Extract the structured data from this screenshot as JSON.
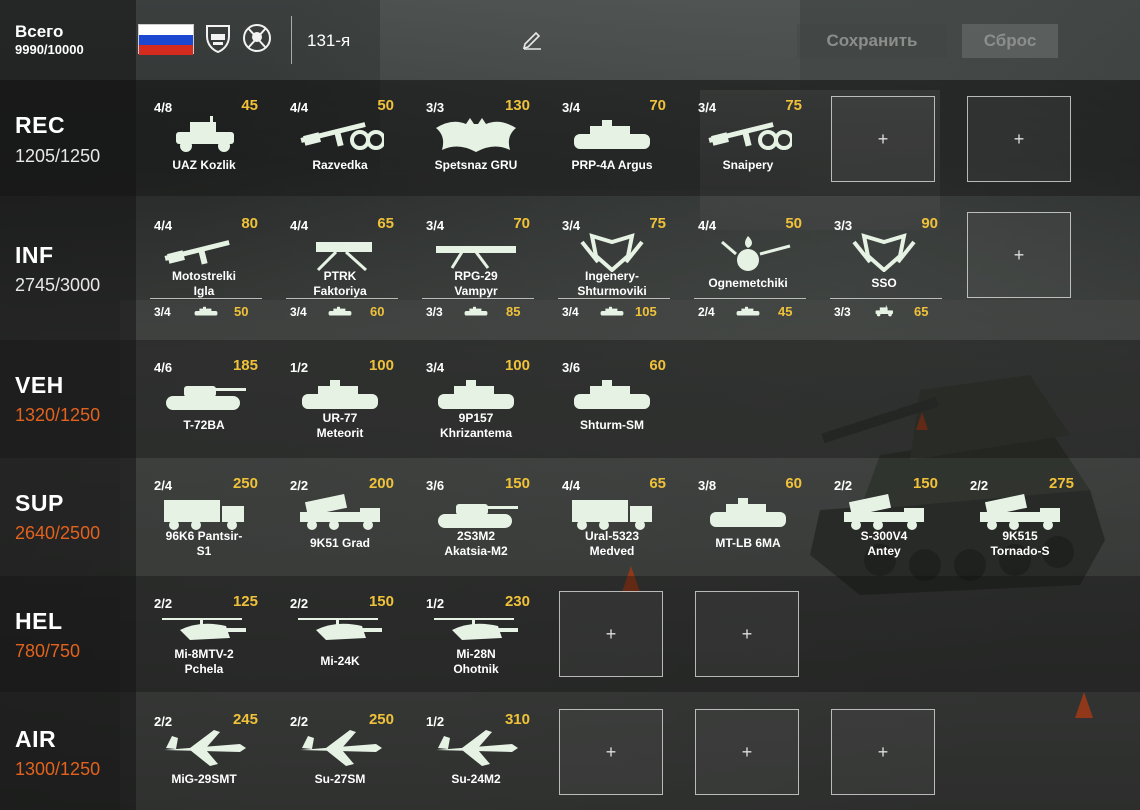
{
  "header": {
    "total_label": "Всего",
    "total_value": "9990/10000",
    "deck_name": "131-я",
    "save_label": "Сохранить",
    "reset_label": "Сброс",
    "flag_colors": [
      "#ffffff",
      "#1c47d1",
      "#d52b1e"
    ]
  },
  "categories": {
    "rec": {
      "name": "REC",
      "points": "1205/1250",
      "units": [
        {
          "count": "4/8",
          "cost": "45",
          "name": "UAZ Kozlik",
          "icon": "jeep-icon"
        },
        {
          "count": "4/4",
          "cost": "50",
          "name": "Razvedka",
          "icon": "rifle-binoculars-icon"
        },
        {
          "count": "3/3",
          "cost": "130",
          "name": "Spetsnaz GRU",
          "icon": "bat-emblem-icon"
        },
        {
          "count": "3/4",
          "cost": "70",
          "name": "PRP-4A Argus",
          "icon": "recon-vehicle-icon"
        },
        {
          "count": "3/4",
          "cost": "75",
          "name": "Snaipery",
          "icon": "sniper-binoculars-icon"
        }
      ],
      "slots": [
        "+",
        "+"
      ]
    },
    "inf": {
      "name": "INF",
      "points": "2745/3000",
      "units": [
        {
          "count": "4/4",
          "cost": "80",
          "name": "Motostrelki",
          "name2": "Igla",
          "icon": "rifle-manpads-icon",
          "sub_count": "3/4",
          "sub_cost": "50"
        },
        {
          "count": "4/4",
          "cost": "65",
          "name": "PTRK",
          "name2": "Faktoriya",
          "icon": "atgm-launcher-icon",
          "sub_count": "3/4",
          "sub_cost": "60"
        },
        {
          "count": "3/4",
          "cost": "70",
          "name": "RPG-29",
          "name2": "Vampyr",
          "icon": "rocket-launcher-icon",
          "sub_count": "3/3",
          "sub_cost": "85"
        },
        {
          "count": "3/4",
          "cost": "75",
          "name": "Ingenery-",
          "name2": "Shturmoviki",
          "icon": "engineer-emblem-icon",
          "sub_count": "3/4",
          "sub_cost": "105"
        },
        {
          "count": "4/4",
          "cost": "50",
          "name": "Ognemetchiki",
          "name2": "",
          "icon": "flamethrower-emblem-icon",
          "sub_count": "2/4",
          "sub_cost": "45"
        },
        {
          "count": "3/3",
          "cost": "90",
          "name": "SSO",
          "name2": "",
          "icon": "sso-emblem-icon",
          "sub_count": "3/3",
          "sub_cost": "65"
        }
      ],
      "slots": [
        "+"
      ]
    },
    "veh": {
      "name": "VEH",
      "points": "1320/1250",
      "units": [
        {
          "count": "4/6",
          "cost": "185",
          "name": "T-72BA",
          "name2": "",
          "icon": "tank-icon"
        },
        {
          "count": "1/2",
          "cost": "100",
          "name": "UR-77",
          "name2": "Meteorit",
          "icon": "mine-clearing-vehicle-icon"
        },
        {
          "count": "3/4",
          "cost": "100",
          "name": "9P157",
          "name2": "Khrizantema",
          "icon": "atgm-vehicle-icon"
        },
        {
          "count": "3/6",
          "cost": "60",
          "name": "Shturm-SM",
          "name2": "",
          "icon": "tracked-atgm-icon"
        }
      ]
    },
    "sup": {
      "name": "SUP",
      "points": "2640/2500",
      "units": [
        {
          "count": "2/4",
          "cost": "250",
          "name": "96K6 Pantsir-",
          "name2": "S1",
          "icon": "aa-vehicle-icon"
        },
        {
          "count": "2/2",
          "cost": "200",
          "name": "9K51 Grad",
          "name2": "",
          "icon": "mlrs-truck-icon"
        },
        {
          "count": "3/6",
          "cost": "150",
          "name": "2S3M2",
          "name2": "Akatsia-M2",
          "icon": "spg-icon"
        },
        {
          "count": "4/4",
          "cost": "65",
          "name": "Ural-5323",
          "name2": "Medved",
          "icon": "supply-truck-icon"
        },
        {
          "count": "3/8",
          "cost": "60",
          "name": "MT-LB 6MA",
          "name2": "",
          "icon": "apc-icon"
        },
        {
          "count": "2/2",
          "cost": "150",
          "name": "S-300V4",
          "name2": "Antey",
          "icon": "sam-launcher-icon"
        },
        {
          "count": "2/2",
          "cost": "275",
          "name": "9K515",
          "name2": "Tornado-S",
          "icon": "heavy-mlrs-icon"
        }
      ]
    },
    "hel": {
      "name": "HEL",
      "points": "780/750",
      "units": [
        {
          "count": "2/2",
          "cost": "125",
          "name": "Mi-8MTV-2",
          "name2": "Pchela",
          "icon": "transport-helicopter-icon"
        },
        {
          "count": "2/2",
          "cost": "150",
          "name": "Mi-24K",
          "name2": "",
          "icon": "attack-helicopter-icon"
        },
        {
          "count": "1/2",
          "cost": "230",
          "name": "Mi-28N",
          "name2": "Ohotnik",
          "icon": "gunship-helicopter-icon"
        }
      ],
      "slots": [
        "+",
        "+"
      ]
    },
    "air": {
      "name": "AIR",
      "points": "1300/1250",
      "units": [
        {
          "count": "2/2",
          "cost": "245",
          "name": "MiG-29SMT",
          "name2": "",
          "icon": "fighter-jet-icon"
        },
        {
          "count": "2/2",
          "cost": "250",
          "name": "Su-27SM",
          "name2": "",
          "icon": "fighter-jet-icon"
        },
        {
          "count": "1/2",
          "cost": "310",
          "name": "Su-24M2",
          "name2": "",
          "icon": "bomber-jet-icon"
        }
      ],
      "slots": [
        "+",
        "+",
        "+"
      ]
    }
  }
}
